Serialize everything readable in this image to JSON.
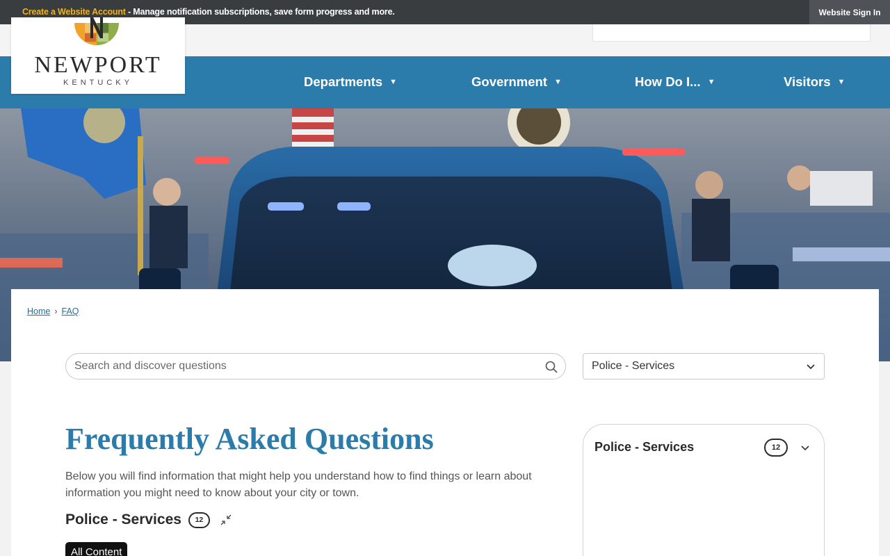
{
  "topbar": {
    "create_account": "Create a Website Account",
    "message": " - Manage notification subscriptions, save form progress and more.",
    "sign_in": "Website Sign In"
  },
  "logo": {
    "name": "NEWPORT",
    "subtitle": "KENTUCKY"
  },
  "nav": {
    "items": [
      {
        "label": "Departments"
      },
      {
        "label": "Government"
      },
      {
        "label": "How Do I..."
      },
      {
        "label": "Visitors"
      }
    ],
    "arrow": "▼"
  },
  "breadcrumb": {
    "home": "Home",
    "separator": "›",
    "current": "FAQ"
  },
  "search": {
    "placeholder": "Search and discover questions",
    "icon": "search-icon"
  },
  "category_select": {
    "selected": "Police - Services"
  },
  "faq": {
    "title": "Frequently Asked Questions",
    "description": "Below you will find information that might help you understand how to find things or learn about information you might need to know about your city or town.",
    "section_title": "Police - Services",
    "section_count": "12",
    "all_content_label": "All Content"
  },
  "side_panel": {
    "title": "Police - Services",
    "count": "12"
  },
  "colors": {
    "brand_blue": "#2b7bab",
    "topbar_bg": "#3a3d40",
    "topbar_link": "#f0b21c"
  }
}
